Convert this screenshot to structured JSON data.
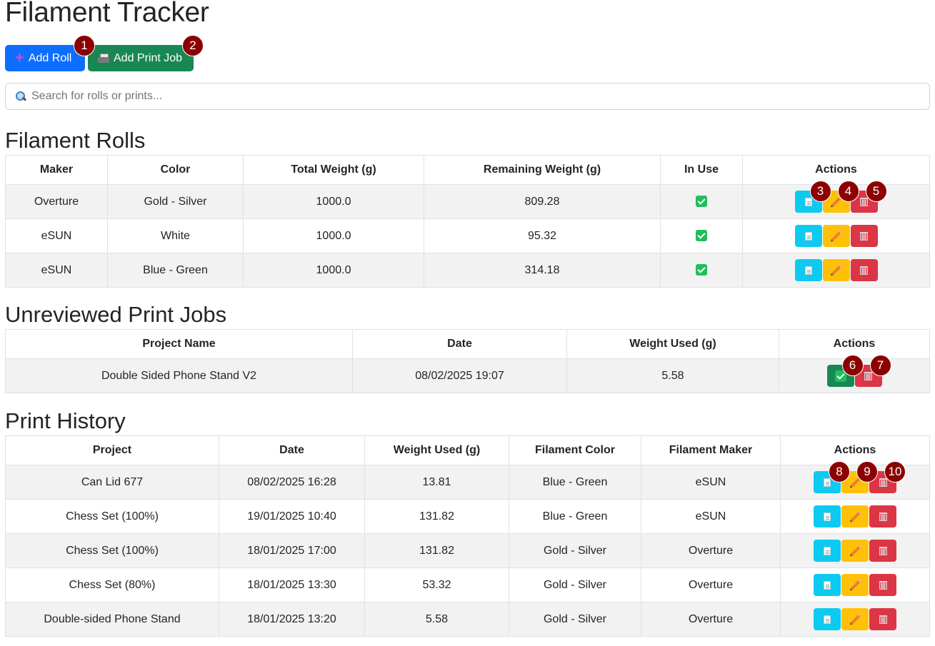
{
  "page": {
    "title": "Filament Tracker",
    "add_roll_label": "Add Roll",
    "add_print_label": "Add Print Job",
    "search_placeholder": "Search for rolls or prints..."
  },
  "annotations": [
    "1",
    "2",
    "3",
    "4",
    "5",
    "6",
    "7",
    "8",
    "9",
    "10"
  ],
  "rolls": {
    "title": "Filament Rolls",
    "headers": [
      "Maker",
      "Color",
      "Total Weight (g)",
      "Remaining Weight (g)",
      "In Use",
      "Actions"
    ],
    "rows": [
      {
        "maker": "Overture",
        "color": "Gold - Silver",
        "total": "1000.0",
        "remaining": "809.28",
        "in_use": true
      },
      {
        "maker": "eSUN",
        "color": "White",
        "total": "1000.0",
        "remaining": "95.32",
        "in_use": true
      },
      {
        "maker": "eSUN",
        "color": "Blue - Green",
        "total": "1000.0",
        "remaining": "314.18",
        "in_use": true
      }
    ]
  },
  "unreviewed": {
    "title": "Unreviewed Print Jobs",
    "headers": [
      "Project Name",
      "Date",
      "Weight Used (g)",
      "Actions"
    ],
    "rows": [
      {
        "project": "Double Sided Phone Stand V2",
        "date": "08/02/2025 19:07",
        "weight": "5.58"
      }
    ]
  },
  "history": {
    "title": "Print History",
    "headers": [
      "Project",
      "Date",
      "Weight Used (g)",
      "Filament Color",
      "Filament Maker",
      "Actions"
    ],
    "rows": [
      {
        "project": "Can Lid 677",
        "date": "08/02/2025 16:28",
        "weight": "13.81",
        "color": "Blue - Green",
        "maker": "eSUN"
      },
      {
        "project": "Chess Set (100%)",
        "date": "19/01/2025 10:40",
        "weight": "131.82",
        "color": "Blue - Green",
        "maker": "eSUN"
      },
      {
        "project": "Chess Set (100%)",
        "date": "18/01/2025 17:00",
        "weight": "131.82",
        "color": "Gold - Silver",
        "maker": "Overture"
      },
      {
        "project": "Chess Set (80%)",
        "date": "18/01/2025 13:30",
        "weight": "53.32",
        "color": "Gold - Silver",
        "maker": "Overture"
      },
      {
        "project": "Double-sided Phone Stand",
        "date": "18/01/2025 13:20",
        "weight": "5.58",
        "color": "Gold - Silver",
        "maker": "Overture"
      }
    ]
  },
  "colors": {
    "primary": "#0d6efd",
    "success": "#198754",
    "info": "#0dcaf0",
    "warning": "#ffc107",
    "danger": "#dc3545",
    "badge": "#8b0000"
  }
}
